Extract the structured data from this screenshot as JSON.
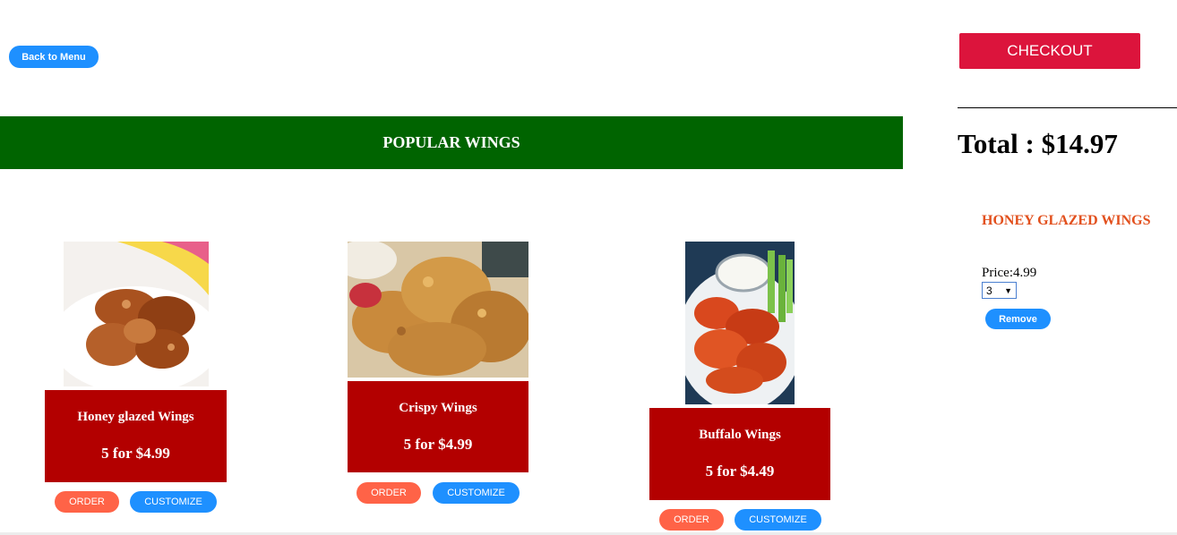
{
  "nav": {
    "back_label": "Back to Menu"
  },
  "section": {
    "title": "POPULAR WINGS"
  },
  "products": [
    {
      "name": "Honey glazed Wings",
      "price": "5 for $4.99",
      "order_label": "ORDER",
      "customize_label": "CUSTOMIZE",
      "image": "honey-glazed-wings-photo"
    },
    {
      "name": "Crispy Wings",
      "price": "5 for $4.99",
      "order_label": "ORDER",
      "customize_label": "CUSTOMIZE",
      "image": "crispy-wings-photo"
    },
    {
      "name": "Buffalo Wings",
      "price": "5 for $4.49",
      "order_label": "ORDER",
      "customize_label": "CUSTOMIZE",
      "image": "buffalo-wings-photo"
    }
  ],
  "cart": {
    "checkout_label": "CHECKOUT",
    "total": "Total : $14.97",
    "items": [
      {
        "name": "HONEY GLAZED WINGS",
        "price_text": "Price:4.99",
        "quantity": "3",
        "remove_label": "Remove"
      }
    ]
  },
  "colors": {
    "banner": "#006400",
    "card": "#b30000",
    "checkout": "#dc143c",
    "primary_button": "#1e90ff",
    "order_button": "#ff6347",
    "cart_item_title": "#e2501d"
  }
}
